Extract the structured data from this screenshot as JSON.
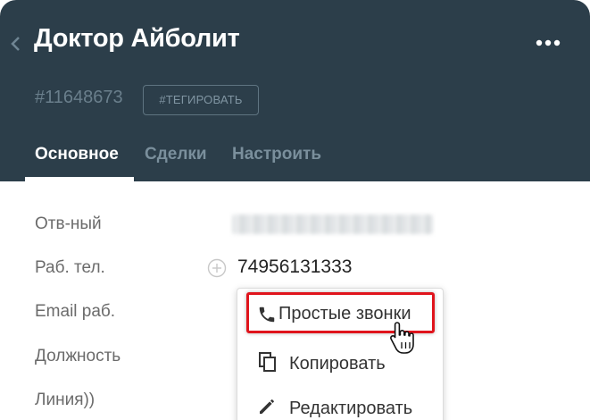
{
  "header": {
    "title": "Доктор Айболит",
    "record_id": "#11648673",
    "tag_button": "#ТЕГИРОВАТЬ",
    "background_color": "#2c3e4a"
  },
  "tabs": [
    {
      "label": "Основное",
      "active": true
    },
    {
      "label": "Сделки",
      "active": false
    },
    {
      "label": "Настроить",
      "active": false
    }
  ],
  "fields": {
    "responsible_label": "Отв-ный",
    "work_phone_label": "Раб. тел.",
    "work_phone_value": "74956131333",
    "work_email_label": "Email раб.",
    "position_label": "Должность",
    "line_label": "Линия))"
  },
  "dropdown": {
    "items": [
      {
        "label": "Простые звонки",
        "icon": "phone-icon",
        "highlighted": true
      },
      {
        "label": "Копировать",
        "icon": "copy-icon",
        "highlighted": false
      },
      {
        "label": "Редактировать",
        "icon": "pencil-icon",
        "highlighted": false
      }
    ],
    "highlight_color": "#e0141c"
  },
  "icons": {
    "back": "chevron-left-icon",
    "more": "more-horizontal-icon",
    "add": "plus-circle-icon",
    "cursor": "hand-pointer-icon"
  }
}
